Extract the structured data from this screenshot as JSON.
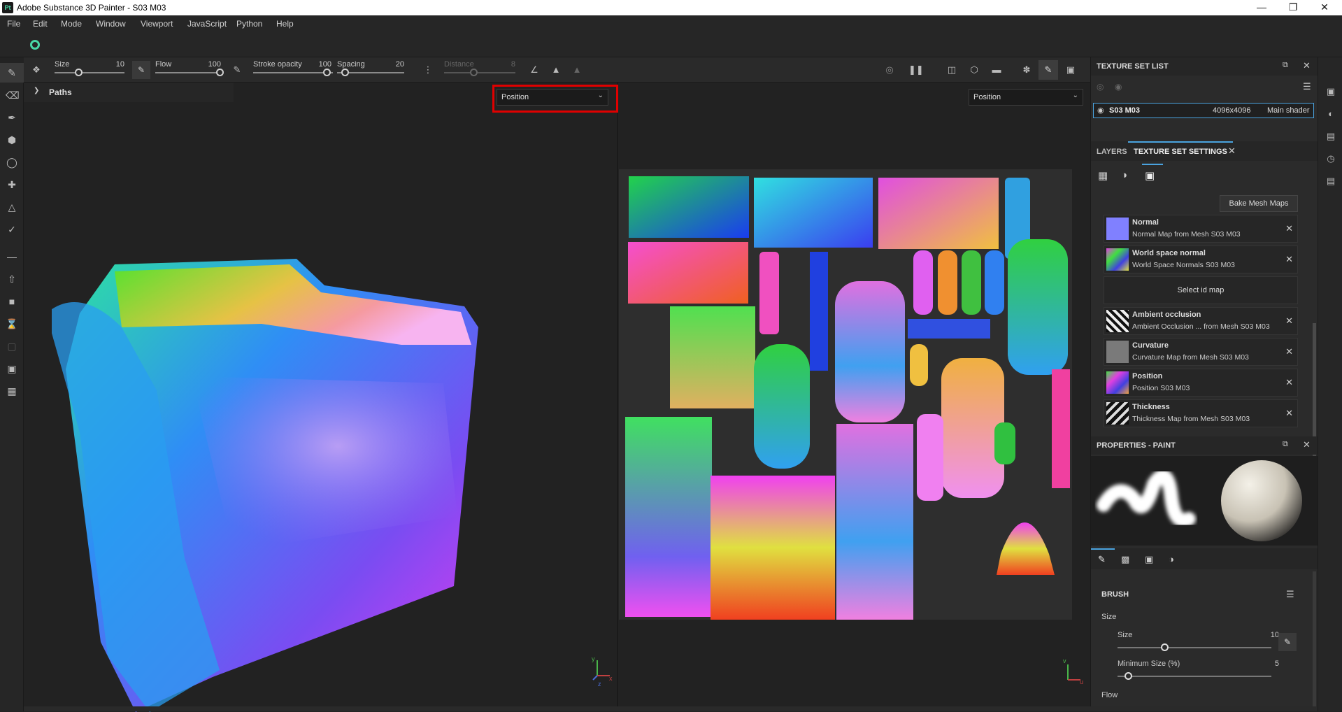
{
  "window": {
    "title": "Adobe Substance 3D Painter - S03 M03",
    "logo": "Pt",
    "buttons": [
      "minimize-icon",
      "restore-icon",
      "close-icon"
    ]
  },
  "menu": [
    "File",
    "Edit",
    "Mode",
    "Window",
    "Viewport",
    "JavaScript",
    "Python",
    "Help"
  ],
  "toolopts": {
    "size_label": "Size",
    "size_value": "10",
    "flow_label": "Flow",
    "flow_value": "100",
    "stroke_label": "Stroke opacity",
    "stroke_value": "100",
    "spacing_label": "Spacing",
    "spacing_value": "20",
    "distance_label": "Distance",
    "distance_value": "8"
  },
  "viewport3d": {
    "paths_label": "Paths",
    "channel_select": "Position",
    "axis_x": "x",
    "axis_y": "y",
    "axis_z": "z"
  },
  "viewport2d": {
    "channel_select": "Position",
    "axis_u": "u",
    "axis_v": "v"
  },
  "texture_set_list": {
    "title": "TEXTURE SET LIST",
    "item": {
      "name": "S03 M03",
      "resolution": "4096x4096",
      "shader": "Main shader"
    }
  },
  "tabs": {
    "layers": "LAYERS",
    "tss": "TEXTURE SET SETTINGS"
  },
  "bake_button": "Bake Mesh Maps",
  "mesh_maps": [
    {
      "name": "Normal",
      "sub": "Normal Map from Mesh S03 M03"
    },
    {
      "name": "World space normal",
      "sub": "World Space Normals S03 M03"
    },
    {
      "name": "Ambient occlusion",
      "sub": "Ambient Occlusion ... from Mesh S03 M03"
    },
    {
      "name": "Curvature",
      "sub": "Curvature Map from Mesh S03 M03"
    },
    {
      "name": "Position",
      "sub": "Position S03 M03"
    },
    {
      "name": "Thickness",
      "sub": "Thickness Map from Mesh S03 M03"
    }
  ],
  "select_id_map": "Select id map",
  "properties": {
    "title": "PROPERTIES - PAINT",
    "brush_header": "BRUSH",
    "size_section": "Size",
    "size_label": "Size",
    "size_value": "10",
    "minsize_label": "Minimum Size (%)",
    "minsize_value": "5",
    "flow_section": "Flow"
  },
  "colors": {
    "accent": "#4aa3df",
    "highlight": "#e00000",
    "panel": "#2b2b2b",
    "viewport": "#222222"
  }
}
